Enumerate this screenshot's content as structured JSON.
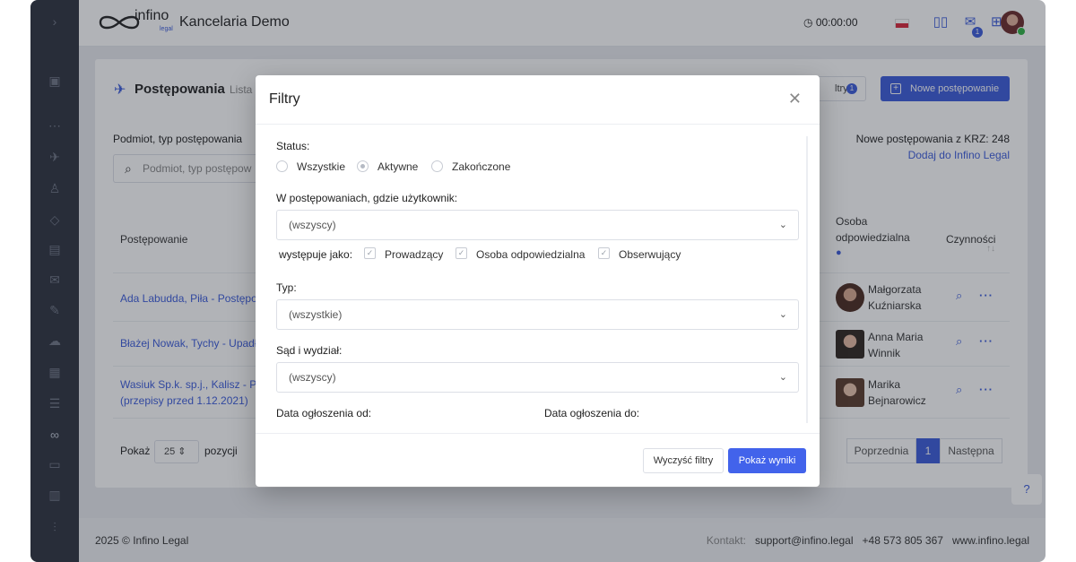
{
  "header": {
    "logo_text": "infino",
    "logo_sub": "legal",
    "title": "Kancelaria Demo",
    "timer": "00:00:00",
    "notif_count": "1"
  },
  "page": {
    "title": "Postępowania",
    "subtitle": "Lista",
    "filters_label": "ltry",
    "filters_count": "1",
    "new_button": "Nowe postępowanie",
    "search_label": "Podmiot, typ postępowania",
    "search_placeholder": "Podmiot, typ postępow",
    "krz_info": "Nowe postępowania z KRZ: 248",
    "krz_link": "Dodaj do Infino Legal"
  },
  "table": {
    "col_postepowanie": "Postępowanie",
    "col_osoba_line1": "Osoba",
    "col_osoba_line2": "odpowiedzialna",
    "col_actions": "Czynności",
    "rows": [
      {
        "case": "Ada Labudda, Piła - Postępo",
        "person_line1": "Małgorzata",
        "person_line2": "Kuźniarska"
      },
      {
        "case": "Błażej Nowak, Tychy - Upadł",
        "person_line1": "Anna Maria",
        "person_line2": "Winnik"
      },
      {
        "case_line1": "Wasiuk Sp.k. sp.j., Kalisz - Po",
        "case_line2": "(przepisy przed 1.12.2021)",
        "person_line1": "Marika",
        "person_line2": "Bejnarowicz"
      }
    ]
  },
  "pagination": {
    "show_label": "Pokaż",
    "page_size": "25",
    "items_label": "pozycji",
    "prev": "Poprzednia",
    "current": "1",
    "next": "Następna"
  },
  "footer": {
    "copyright": "2025 © Infino Legal",
    "contact_label": "Kontakt:",
    "email": "support@infino.legal",
    "phone": "+48 573 805 367",
    "website": "www.infino.legal"
  },
  "modal": {
    "title": "Filtry",
    "status_label": "Status:",
    "status_options": [
      "Wszystkie",
      "Aktywne",
      "Zakończone"
    ],
    "status_selected": "Aktywne",
    "user_label": "W postępowaniach, gdzie użytkownik:",
    "user_value": "(wszyscy)",
    "role_label": "występuje jako:",
    "roles": [
      "Prowadzący",
      "Osoba odpowiedzialna",
      "Obserwujący"
    ],
    "type_label": "Typ:",
    "type_value": "(wszystkie)",
    "court_label": "Sąd i wydział:",
    "court_value": "(wszyscy)",
    "date_from_label": "Data ogłoszenia od:",
    "date_to_label": "Data ogłoszenia do:",
    "clear_button": "Wyczyść filtry",
    "show_button": "Pokaż wyniki"
  },
  "colors": {
    "accent": "#3b5bdb",
    "sidebar": "#2d323e"
  }
}
